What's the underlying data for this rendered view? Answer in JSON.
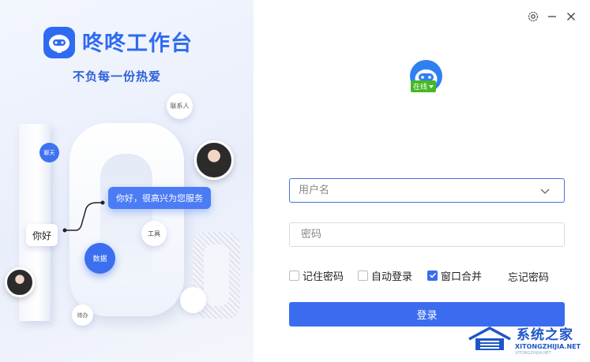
{
  "brand": {
    "name": "咚咚工作台",
    "slogan": "不负每一份热爱"
  },
  "illustration": {
    "contacts": "联系人",
    "chat": "聊天",
    "tools": "工具",
    "data": "数据",
    "todo": "待办",
    "greeting_reply": "你好，很高兴为您服务",
    "greeting": "你好"
  },
  "window": {
    "settings_icon": "gear-icon",
    "minimize_icon": "minimize-icon",
    "close_icon": "close-icon"
  },
  "status": {
    "label": "在线",
    "color": "#46b823"
  },
  "form": {
    "username_placeholder": "用户名",
    "password_placeholder": "密码",
    "remember_label": "记住密码",
    "remember_checked": false,
    "autologin_label": "自动登录",
    "autologin_checked": false,
    "merge_label": "窗口合并",
    "merge_checked": true,
    "forgot_label": "忘记密码",
    "login_label": "登录"
  },
  "colors": {
    "accent": "#3b6cf0",
    "brand": "#2f6bf2"
  },
  "watermark": {
    "title": "系统之家",
    "subtitle": "XITONGZHIJIA.NET",
    "subtitle2": "XITONGZHIJIA.NET"
  }
}
